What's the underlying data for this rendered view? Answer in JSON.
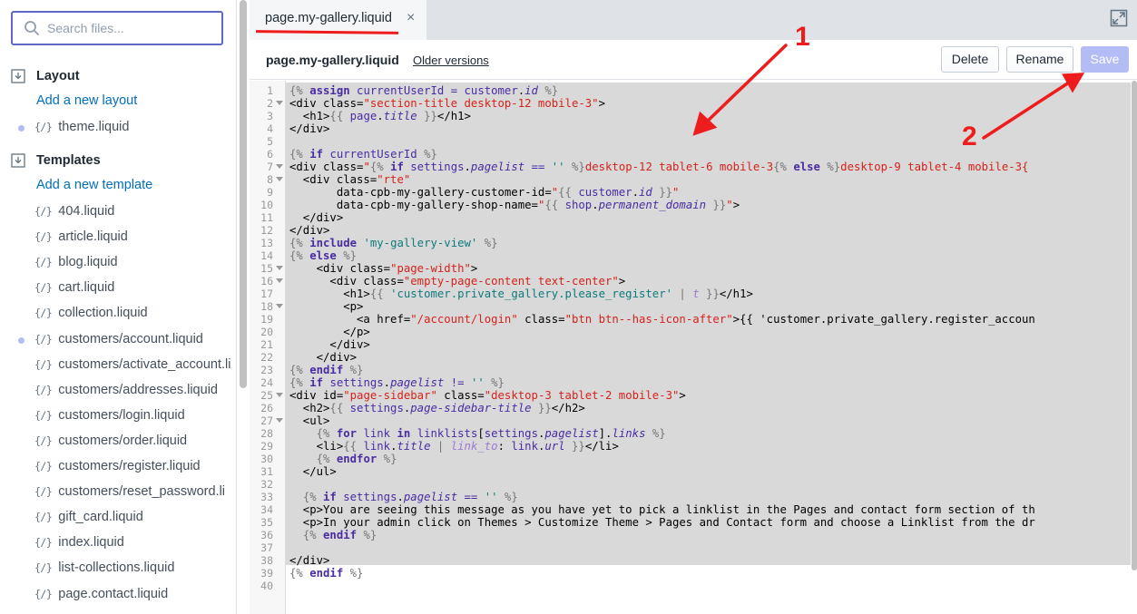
{
  "sidebar": {
    "search_placeholder": "Search files...",
    "sections": [
      {
        "title": "Layout",
        "add_label": "Add a new layout",
        "files": [
          "theme.liquid"
        ]
      },
      {
        "title": "Templates",
        "add_label": "Add a new template",
        "files": [
          "404.liquid",
          "article.liquid",
          "blog.liquid",
          "cart.liquid",
          "collection.liquid",
          "customers/account.liquid",
          "customers/activate_account.li",
          "customers/addresses.liquid",
          "customers/login.liquid",
          "customers/order.liquid",
          "customers/register.liquid",
          "customers/reset_password.li",
          "gift_card.liquid",
          "index.liquid",
          "list-collections.liquid",
          "page.contact.liquid"
        ]
      }
    ],
    "file_icon": "{/}"
  },
  "tab": {
    "label": "page.my-gallery.liquid",
    "close": "×"
  },
  "header": {
    "filename": "page.my-gallery.liquid",
    "older_versions": "Older versions",
    "delete_label": "Delete",
    "rename_label": "Rename",
    "save_label": "Save"
  },
  "annotations": {
    "one": "1",
    "two": "2",
    "color": "#ee1c1c"
  },
  "editor": {
    "lines": [
      "{% assign currentUserId = customer.id %}",
      "<div class=\"section-title desktop-12 mobile-3\">",
      "  <h1>{{ page.title }}</h1>",
      "</div>",
      "",
      "{% if currentUserId %}",
      "<div class=\"{% if settings.pagelist == '' %}desktop-12 tablet-6 mobile-3{% else %}desktop-9 tablet-4 mobile-3{",
      "  <div class=\"rte\"",
      "       data-cpb-my-gallery-customer-id=\"{{ customer.id }}\"",
      "       data-cpb-my-gallery-shop-name=\"{{ shop.permanent_domain }}\">",
      "  </div>",
      "</div>",
      "{% include 'my-gallery-view' %}",
      "{% else %}",
      "    <div class=\"page-width\">",
      "      <div class=\"empty-page-content text-center\">",
      "        <h1>{{ 'customer.private_gallery.please_register' | t }}</h1>",
      "        <p>",
      "          <a href=\"/account/login\" class=\"btn btn--has-icon-after\">{{ 'customer.private_gallery.register_accoun",
      "        </p>",
      "      </div>",
      "    </div>",
      "{% endif %}",
      "{% if settings.pagelist != '' %}",
      "<div id=\"page-sidebar\" class=\"desktop-3 tablet-2 mobile-3\">",
      "  <h2>{{ settings.page-sidebar-title }}</h2>",
      "  <ul>",
      "    {% for link in linklists[settings.pagelist].links %}",
      "    <li>{{ link.title | link_to: link.url }}</li>",
      "    {% endfor %}",
      "  </ul>",
      "",
      "  {% if settings.pagelist == '' %}",
      "  <p>You are seeing this message as you have yet to pick a linklist in the Pages and contact form section of th",
      "  <p>In your admin click on Themes > Customize Theme > Pages and Contact form and choose a Linklist from the dr",
      "  {% endif %}",
      "",
      "</div>",
      "{% endif %}",
      ""
    ]
  }
}
